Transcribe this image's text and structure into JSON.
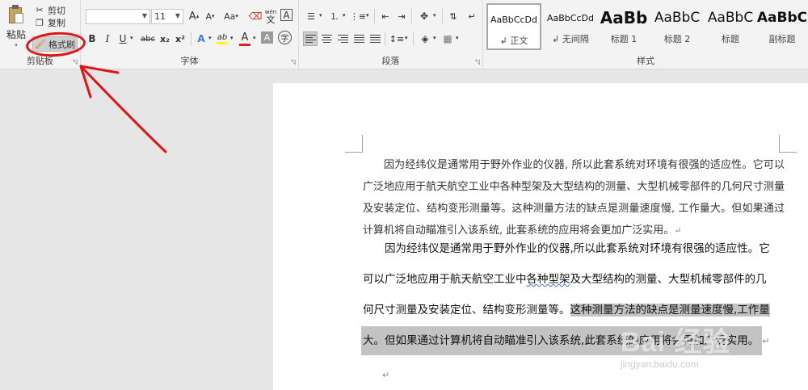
{
  "ribbon": {
    "clipboard": {
      "label": "剪贴板",
      "paste": "粘贴",
      "cut": "剪切",
      "copy": "复制",
      "format_painter": "格式刷"
    },
    "font": {
      "label": "字体",
      "font_name": "",
      "font_size": "11",
      "grow": "A",
      "shrink": "A",
      "change_case": "Aa",
      "phonetic": "wén",
      "char_border": "A",
      "bold": "B",
      "italic": "I",
      "underline": "U",
      "strikethrough": "abc",
      "subscript": "x₂",
      "superscript": "x²",
      "text_effect": "A",
      "highlight": "ab",
      "font_color": "A",
      "char_shading": "A",
      "enclose": "字"
    },
    "paragraph": {
      "label": "段落"
    },
    "styles": {
      "label": "样式",
      "items": [
        {
          "sample": "AaBbCcDd",
          "name": "正文"
        },
        {
          "sample": "AaBbCcDd",
          "name": "无间隔"
        },
        {
          "sample": "AaBb",
          "name": "标题 1"
        },
        {
          "sample": "AaBbC",
          "name": "标题 2"
        },
        {
          "sample": "AaBbC",
          "name": "标题"
        },
        {
          "sample": "AaBbC",
          "name": "副标题"
        }
      ]
    }
  },
  "colors": {
    "accent_red": "#e01414",
    "selection": "#c3c3c3",
    "font_color_bar": "#e0201b",
    "highlight_bar": "#ffff00"
  },
  "document": {
    "para1": "因为经纬仪是通常用于野外作业的仪器, 所以此套系统对环境有很强的适应性。它可以广泛地应用于航天航空工业中各种型架及大型结构的测量、大型机械零部件的几何尺寸测量及安装定位、结构变形测量等。这种测量方法的缺点是测量速度慢, 工作量大。但如果通过计算机将自动瞄准引入该系统, 此套系统的应用将会更加广泛实用。",
    "para2": {
      "l1": "因为经纬仪是通常用于野外作业的仪器,所以此套系统对环境有很强的适应性。它",
      "l2a": "可以广泛地应用于航天航空工业中",
      "l2b": "各种型架",
      "l2c": "及大型结构的测量、大型机械零部件的几",
      "l3a": "何尺寸测量及安装定位、结构变形测量等。",
      "l3b": "这种测量方法的缺点是测量速度慢,工作量",
      "l4": "大。但如果通过计算机将自动瞄准引入该系统,此套系统的应用将会更加广泛实用。"
    },
    "para_mark": "↵"
  },
  "watermark": {
    "main": "Bai 经验",
    "sub": "jingyan.baidu.com"
  }
}
